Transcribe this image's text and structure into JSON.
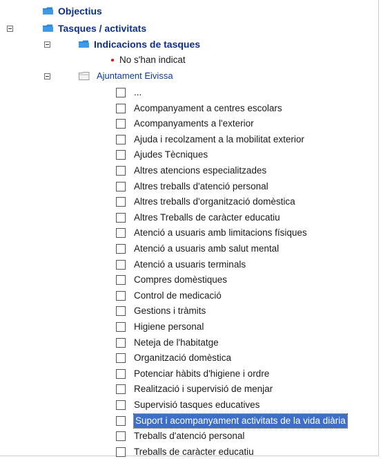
{
  "tree": {
    "objectius": "Objectius",
    "tasques": "Tasques / activitats",
    "indicacions": "Indicacions de tasques",
    "no_indicat": "No s'han indicat",
    "ajuntament": "Ajuntament Eivissa",
    "items": [
      "...",
      "Acompanyament a centres escolars",
      "Acompanyaments a l'exterior",
      "Ajuda i recolzament a la mobilitat exterior",
      "Ajudes Tècniques",
      "Altres atencions especialitzades",
      "Altres treballs d'atenció personal",
      "Altres treballs d'organització domèstica",
      "Altres Treballs de caràcter educatiu",
      "Atenció a usuaris amb limitacions físiques",
      "Atenció a usuaris amb salut mental",
      "Atenció a usuaris terminals",
      "Compres domèstiques",
      "Control de medicació",
      "Gestions i tràmits",
      "Higiene personal",
      "Neteja de l'habitatge",
      "Organització domèstica",
      "Potenciar hàbits d'higiene i ordre",
      "Realització i supervisió de menjar",
      "Supervisió tasques educatives",
      "Suport i acompanyament activitats de la vida diària",
      "Treballs d'atenció personal",
      "Treballs de caràcter educatiu"
    ],
    "selected_index": 21
  },
  "colors": {
    "folder_blue": "#2a86d6",
    "selection": "#3d6fc9",
    "bold_label": "#0d2f8a"
  }
}
